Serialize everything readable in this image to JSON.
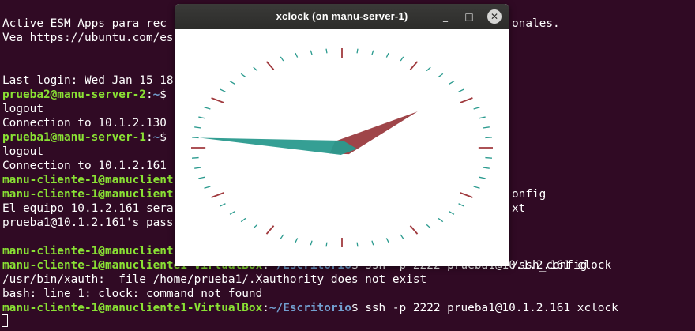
{
  "terminal": {
    "lines": [
      {
        "parts": [
          {
            "text": "Active ESM Apps para rec",
            "color": "white"
          },
          {
            "text": "onales.",
            "color": "white"
          }
        ]
      },
      {
        "parts": [
          {
            "text": "Vea https://ubuntu.com/es",
            "color": "white"
          }
        ]
      },
      {
        "parts": []
      },
      {
        "parts": []
      },
      {
        "parts": [
          {
            "text": "Last login: Wed Jan 15 18",
            "color": "white"
          }
        ]
      },
      {
        "parts": [
          {
            "text": "prueba2@manu-server-2",
            "color": "green"
          },
          {
            "text": ":",
            "color": "white"
          },
          {
            "text": "~",
            "color": "blue"
          },
          {
            "text": "$",
            "color": "white"
          }
        ]
      },
      {
        "parts": [
          {
            "text": "logout",
            "color": "white"
          }
        ]
      },
      {
        "parts": [
          {
            "text": "Connection to 10.1.2.130",
            "color": "white"
          }
        ]
      },
      {
        "parts": [
          {
            "text": "prueba1@manu-server-1",
            "color": "green"
          },
          {
            "text": ":",
            "color": "white"
          },
          {
            "text": "~",
            "color": "blue"
          },
          {
            "text": "$",
            "color": "white"
          }
        ]
      },
      {
        "parts": [
          {
            "text": "logout",
            "color": "white"
          }
        ]
      },
      {
        "parts": [
          {
            "text": "Connection to 10.1.2.161",
            "color": "white"
          }
        ]
      },
      {
        "parts": [
          {
            "text": "manu-cliente-1@manuclient",
            "color": "green"
          }
        ]
      },
      {
        "parts": [
          {
            "text": "manu-cliente-1@manuclient",
            "color": "green"
          }
        ]
      },
      {
        "parts": [
          {
            "text": "El equipo 10.1.2.161 sera",
            "color": "white"
          }
        ]
      },
      {
        "parts": [
          {
            "text": "prueba1@10.1.2.161's pass",
            "color": "white"
          }
        ]
      },
      {
        "parts": []
      },
      {
        "parts": [
          {
            "text": "manu-cliente-1@manuclient",
            "color": "green"
          }
        ]
      },
      {
        "parts": [
          {
            "text": "manu-cliente-1@manucliente1-VirtualBox",
            "color": "green"
          },
          {
            "text": ":",
            "color": "white"
          },
          {
            "text": "~/Escritorio",
            "color": "blue"
          },
          {
            "text": "$ ssh -p 2222 prueba1@10.1.2.161 clock",
            "color": "white"
          }
        ]
      },
      {
        "parts": [
          {
            "text": "/usr/bin/xauth:  file /home/prueba1/.Xauthority does not exist",
            "color": "white"
          }
        ]
      },
      {
        "parts": [
          {
            "text": "bash: line 1: clock: command not found",
            "color": "white"
          }
        ]
      },
      {
        "parts": [
          {
            "text": "manu-cliente-1@manucliente1-VirtualBox",
            "color": "green"
          },
          {
            "text": ":",
            "color": "white"
          },
          {
            "text": "~/Escritorio",
            "color": "blue"
          },
          {
            "text": "$ ssh -p 2222 prueba1@10.1.2.161 xclock",
            "color": "white"
          }
        ]
      }
    ],
    "right_fragments": [
      {
        "line": 12,
        "text": "onfig"
      },
      {
        "line": 13,
        "text": "xt"
      },
      {
        "line": 17,
        "text": "/ssh_config"
      }
    ]
  },
  "window": {
    "title": "xclock (on manu-server-1)",
    "minimize_glyph": "_",
    "maximize_glyph": "□",
    "close_glyph": "✕"
  },
  "clock": {
    "hour_value": 1.8,
    "minute_value": 9.2,
    "colors": {
      "major_tick": "#a03a3e",
      "minor_tick": "#2a9a8e",
      "hour_hand": "#9a3b3f",
      "minute_hand": "#2a9a8e"
    }
  }
}
